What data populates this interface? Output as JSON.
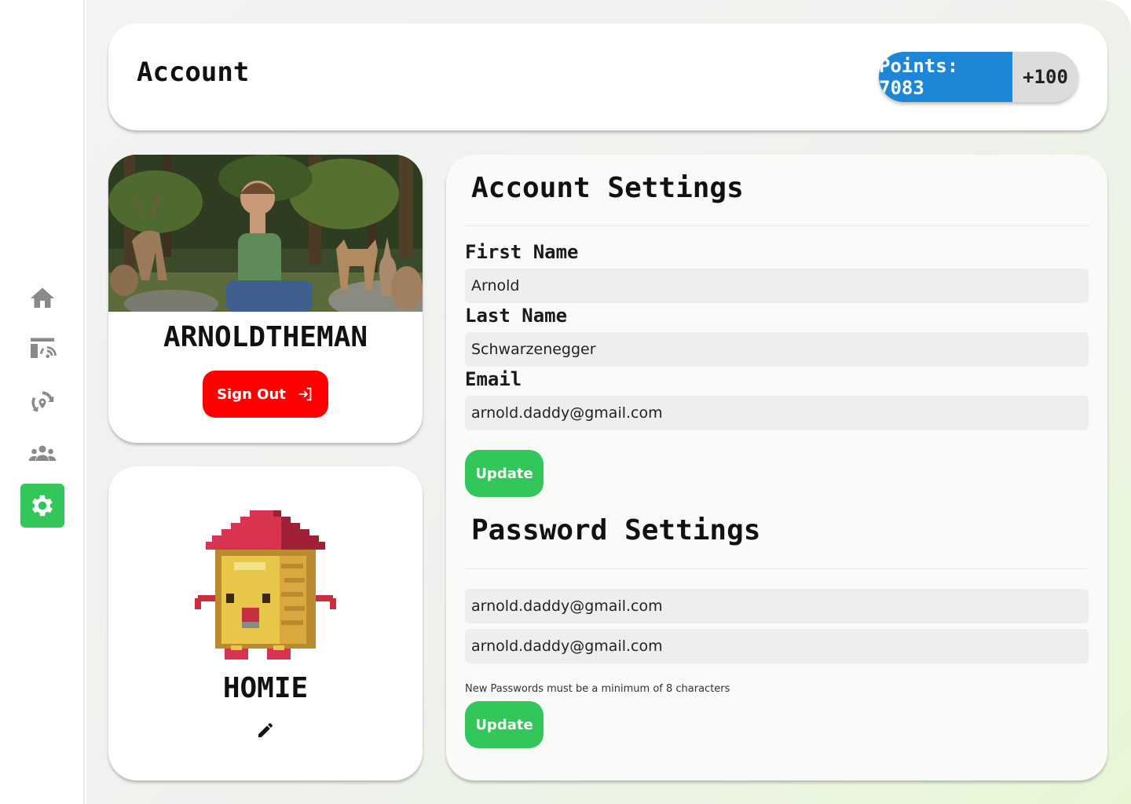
{
  "header": {
    "title": "Account",
    "points_label": "Points: 7083",
    "bonus_label": "+100"
  },
  "sidebar": {
    "items": [
      {
        "icon": "home-icon",
        "active": false
      },
      {
        "icon": "smart-home-icon",
        "active": false
      },
      {
        "icon": "recycle-location-icon",
        "active": false
      },
      {
        "icon": "users-icon",
        "active": false
      },
      {
        "icon": "gear-icon",
        "active": true
      }
    ]
  },
  "profile": {
    "username": "ARNOLDTHEMAN",
    "signout_label": "Sign Out"
  },
  "homie": {
    "name": "HOMIE"
  },
  "account_settings": {
    "title": "Account Settings",
    "first_name_label": "First Name",
    "first_name_value": "Arnold",
    "last_name_label": "Last Name",
    "last_name_value": "Schwarzenegger",
    "email_label": "Email",
    "email_value": "arnold.daddy@gmail.com",
    "update_label": "Update"
  },
  "password_settings": {
    "title": "Password Settings",
    "new_password_value": "arnold.daddy@gmail.com",
    "confirm_password_value": "arnold.daddy@gmail.com",
    "hint": "New Passwords must be a minimum of 8 characters",
    "update_label": "Update"
  },
  "colors": {
    "accent_green": "#33c65a",
    "points_blue": "#1e86d6",
    "signout_red": "#ff0000"
  }
}
